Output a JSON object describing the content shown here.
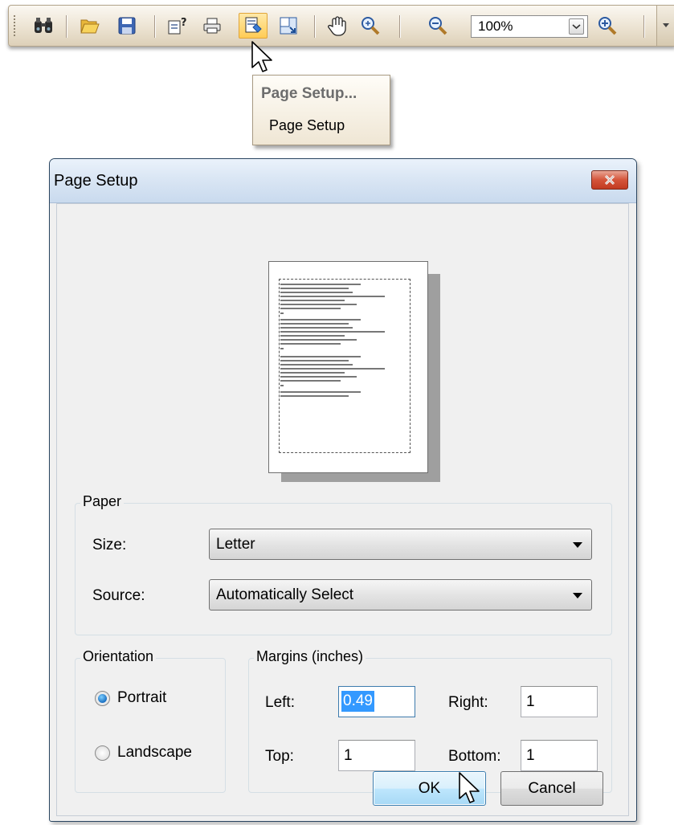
{
  "toolbar": {
    "buttons": [
      {
        "name": "find-icon"
      },
      {
        "name": "open-icon"
      },
      {
        "name": "save-icon"
      },
      {
        "name": "customize-icon"
      },
      {
        "name": "print-icon"
      },
      {
        "name": "page-setup-icon"
      },
      {
        "name": "scale-icon"
      },
      {
        "name": "hand-tool-icon"
      },
      {
        "name": "magnifier-icon"
      },
      {
        "name": "zoom-out-icon"
      },
      {
        "name": "zoom-in-icon"
      }
    ],
    "zoom_value": "100%"
  },
  "tooltip": {
    "title": "Page Setup...",
    "description": "Page Setup"
  },
  "dialog": {
    "title": "Page Setup",
    "paper": {
      "legend": "Paper",
      "size_label": "Size:",
      "size_value": "Letter",
      "source_label": "Source:",
      "source_value": "Automatically Select"
    },
    "orientation": {
      "legend": "Orientation",
      "portrait_label": "Portrait",
      "landscape_label": "Landscape",
      "selected": "Portrait"
    },
    "margins": {
      "legend": "Margins (inches)",
      "left_label": "Left:",
      "left_value": "0.49",
      "right_label": "Right:",
      "right_value": "1",
      "top_label": "Top:",
      "top_value": "1",
      "bottom_label": "Bottom:",
      "bottom_value": "1"
    },
    "ok_label": "OK",
    "cancel_label": "Cancel"
  },
  "colors": {
    "toolbar_bg": "#ece3d2",
    "dialog_bg": "#f0f0f0",
    "titlebar": "#dae6f4",
    "close_button": "#d4543a",
    "selection": "#3399ff"
  }
}
